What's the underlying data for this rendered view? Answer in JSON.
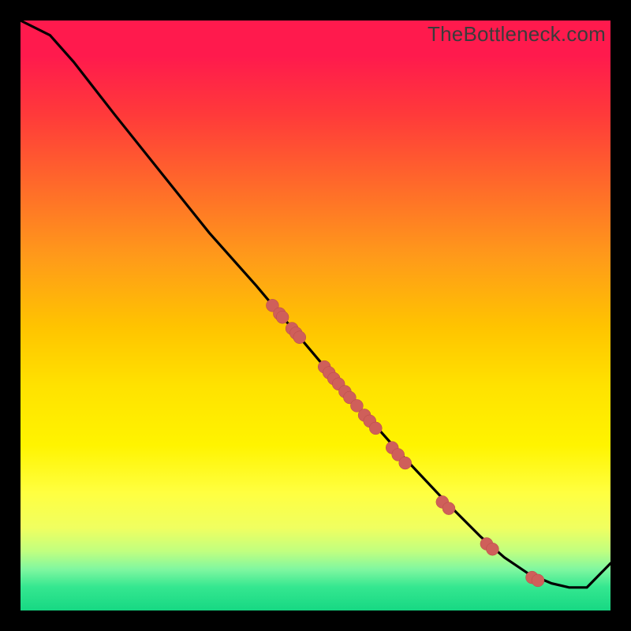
{
  "watermark": "TheBottleneck.com",
  "colors": {
    "background": "#000000",
    "curve": "#000000",
    "marker_fill": "#cf5f5a",
    "marker_stroke": "#b84a47"
  },
  "chart_data": {
    "type": "line",
    "title": "",
    "xlabel": "",
    "ylabel": "",
    "xlim": [
      0,
      100
    ],
    "ylim": [
      0,
      100
    ],
    "grid": false,
    "note": "No numeric axes visible; x/y in percent of plot area (0,0 = bottom-left).",
    "series": [
      {
        "name": "bottleneck-curve",
        "x": [
          0,
          5,
          9,
          16,
          24,
          32,
          40,
          48,
          56,
          64,
          72,
          78,
          82,
          86,
          90,
          93,
          96,
          100
        ],
        "y": [
          100,
          97.5,
          93,
          84,
          74,
          64,
          55,
          45.5,
          36,
          27,
          18.5,
          12.5,
          9,
          6.3,
          4.6,
          3.9,
          3.9,
          8
        ]
      }
    ],
    "markers": {
      "name": "highlighted-points",
      "x": [
        42.7,
        43.9,
        44.4,
        46.0,
        46.7,
        47.3,
        51.5,
        52.3,
        53.1,
        53.9,
        55.0,
        55.8,
        57.0,
        58.3,
        59.2,
        60.2,
        63.0,
        64.0,
        65.2,
        71.5,
        72.6,
        79.0,
        80.0,
        86.7,
        87.7
      ],
      "y": [
        51.7,
        50.3,
        49.7,
        47.8,
        47.0,
        46.3,
        41.3,
        40.3,
        39.3,
        38.4,
        37.1,
        36.1,
        34.7,
        33.1,
        32.1,
        30.9,
        27.6,
        26.4,
        25.0,
        18.4,
        17.3,
        11.3,
        10.4,
        5.6,
        5.1
      ],
      "radius": 8
    }
  }
}
